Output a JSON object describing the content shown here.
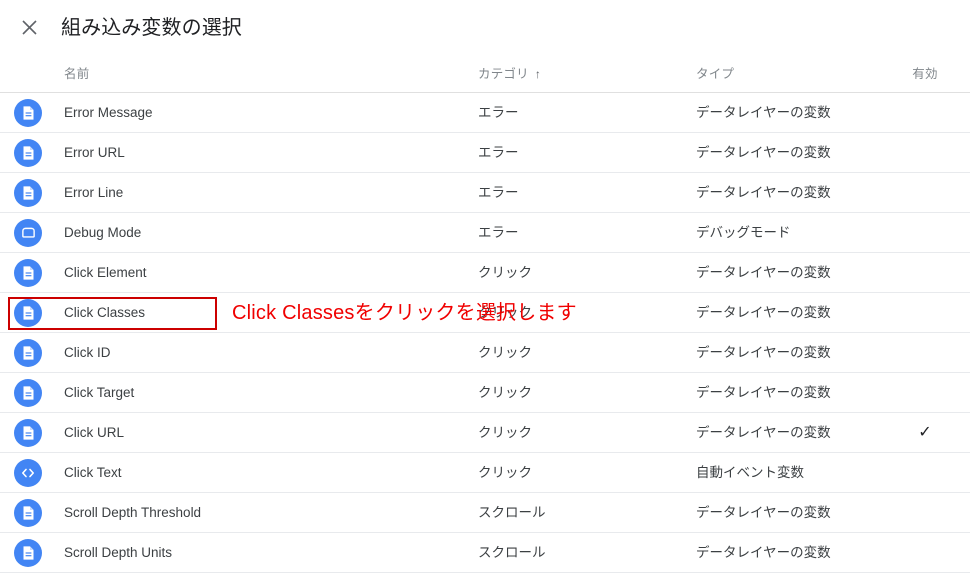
{
  "dialog": {
    "title": "組み込み変数の選択",
    "close_icon": "close-icon"
  },
  "table": {
    "headers": {
      "name": "名前",
      "category": "カテゴリ",
      "category_sort_arrow": "↑",
      "type": "タイプ",
      "enabled": "有効"
    },
    "rows": [
      {
        "icon": "document-icon",
        "name": "Error Message",
        "category": "エラー",
        "type": "データレイヤーの変数",
        "enabled": ""
      },
      {
        "icon": "document-icon",
        "name": "Error URL",
        "category": "エラー",
        "type": "データレイヤーの変数",
        "enabled": ""
      },
      {
        "icon": "document-icon",
        "name": "Error Line",
        "category": "エラー",
        "type": "データレイヤーの変数",
        "enabled": ""
      },
      {
        "icon": "debug-icon",
        "name": "Debug Mode",
        "category": "エラー",
        "type": "デバッグモード",
        "enabled": ""
      },
      {
        "icon": "document-icon",
        "name": "Click Element",
        "category": "クリック",
        "type": "データレイヤーの変数",
        "enabled": ""
      },
      {
        "icon": "document-icon",
        "name": "Click Classes",
        "category": "クリック",
        "type": "データレイヤーの変数",
        "enabled": ""
      },
      {
        "icon": "document-icon",
        "name": "Click ID",
        "category": "クリック",
        "type": "データレイヤーの変数",
        "enabled": ""
      },
      {
        "icon": "document-icon",
        "name": "Click Target",
        "category": "クリック",
        "type": "データレイヤーの変数",
        "enabled": ""
      },
      {
        "icon": "document-icon",
        "name": "Click URL",
        "category": "クリック",
        "type": "データレイヤーの変数",
        "enabled": "✓"
      },
      {
        "icon": "code-icon",
        "name": "Click Text",
        "category": "クリック",
        "type": "自動イベント変数",
        "enabled": ""
      },
      {
        "icon": "document-icon",
        "name": "Scroll Depth Threshold",
        "category": "スクロール",
        "type": "データレイヤーの変数",
        "enabled": ""
      },
      {
        "icon": "document-icon",
        "name": "Scroll Depth Units",
        "category": "スクロール",
        "type": "データレイヤーの変数",
        "enabled": ""
      }
    ]
  },
  "annotation": {
    "text": "Click Classesをクリックを選択します",
    "color": "#f00000",
    "box_color": "#cc0000",
    "target_row": "Click Classes"
  },
  "colors": {
    "icon_blue": "#4285f4",
    "text_primary": "#3c4043",
    "text_secondary": "#80868b",
    "divider": "#e8eaed"
  }
}
